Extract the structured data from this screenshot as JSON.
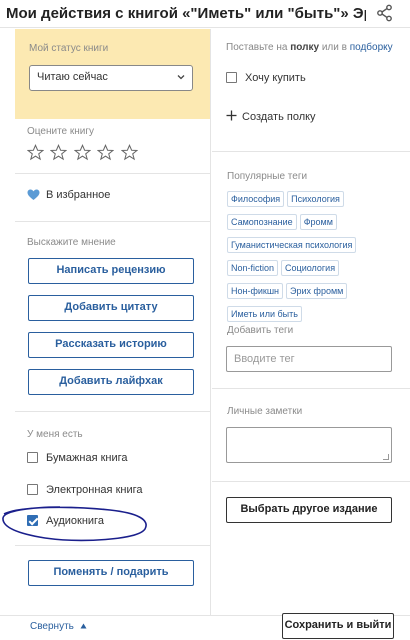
{
  "header": {
    "title": "Мои действия с книгой «\"Иметь\" или \"быть\"» Эрих Фромм",
    "share_icon": "share-icon"
  },
  "status": {
    "label": "Мой статус книги",
    "selected": "Читаю сейчас"
  },
  "rating": {
    "label": "Оцените книгу",
    "stars": 5,
    "filled": 0
  },
  "favorite": {
    "label": "В избранное",
    "icon": "heart-icon",
    "icon_color": "#5b9bd5"
  },
  "opinion": {
    "label": "Выскажите мнение",
    "buttons": [
      "Написать рецензию",
      "Добавить цитату",
      "Рассказать историю",
      "Добавить лайфхак"
    ]
  },
  "owned": {
    "label": "У меня есть",
    "items": [
      {
        "label": "Бумажная книга",
        "checked": false
      },
      {
        "label": "Электронная книга",
        "checked": false
      },
      {
        "label": "Аудиокнига",
        "checked": true
      }
    ]
  },
  "exchange_button": "Поменять / подарить",
  "shelf": {
    "prefix": "Поставьте на",
    "shelf_word": "полку",
    "middle": "или в",
    "selection_link": "подборку",
    "want_buy": "Хочу купить",
    "create_shelf": "Создать полку"
  },
  "popular_tags": {
    "label": "Популярные теги",
    "tags": [
      "Философия",
      "Психология",
      "Самопознание",
      "Фромм",
      "Гуманистическая психология",
      "Non-fiction",
      "Социология",
      "Нон-фикшн",
      "Эрих фромм",
      "Иметь или быть"
    ]
  },
  "add_tags": {
    "label": "Добавить теги",
    "placeholder": "Вводите тег"
  },
  "notes": {
    "label": "Личные заметки"
  },
  "choose_edition": "Выбрать другое издание",
  "footer": {
    "collapse": "Свернуть",
    "save_exit": "Сохранить и выйти"
  },
  "colors": {
    "accent": "#2a5f9e",
    "status_bg": "#fce9b2",
    "checkbox": "#2f6db4",
    "pen_annotation": "#1a1f8c"
  }
}
